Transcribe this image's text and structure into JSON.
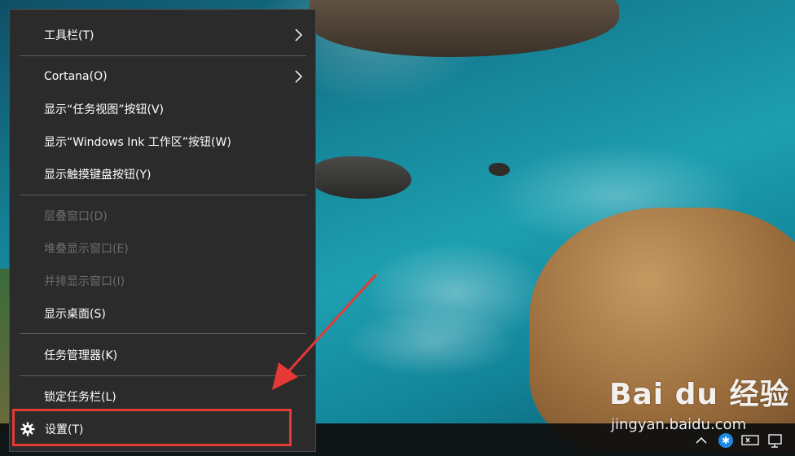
{
  "menu": {
    "items": [
      {
        "label": "工具栏(T)",
        "submenu": true,
        "enabled": true
      },
      {
        "label": "Cortana(O)",
        "submenu": true,
        "enabled": true
      },
      {
        "label": "显示“任务视图”按钮(V)",
        "submenu": false,
        "enabled": true
      },
      {
        "label": "显示“Windows Ink 工作区”按钮(W)",
        "submenu": false,
        "enabled": true
      },
      {
        "label": "显示触摸键盘按钮(Y)",
        "submenu": false,
        "enabled": true
      },
      {
        "label": "层叠窗口(D)",
        "submenu": false,
        "enabled": false
      },
      {
        "label": "堆叠显示窗口(E)",
        "submenu": false,
        "enabled": false
      },
      {
        "label": "并排显示窗口(I)",
        "submenu": false,
        "enabled": false
      },
      {
        "label": "显示桌面(S)",
        "submenu": false,
        "enabled": true
      },
      {
        "label": "任务管理器(K)",
        "submenu": false,
        "enabled": true
      },
      {
        "label": "锁定任务栏(L)",
        "submenu": false,
        "enabled": true
      },
      {
        "label": "设置(T)",
        "submenu": false,
        "enabled": true,
        "icon": "gear-icon"
      }
    ]
  },
  "tray": {
    "icons": [
      "chevron-up-icon",
      "app-tray-icon",
      "network-icon",
      "monitor-icon"
    ]
  },
  "watermark": {
    "logo": "Bai du 经验",
    "url": "jingyan.baidu.com"
  },
  "colors": {
    "menu_bg": "#2b2b2b",
    "menu_text": "#ffffff",
    "menu_disabled_text": "#6d6d6d",
    "annotation": "#e53935",
    "taskbar": "#101010"
  }
}
